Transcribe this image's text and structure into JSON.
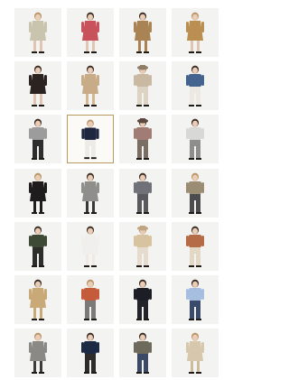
{
  "colors": {
    "skin": "#e9cdb7",
    "hair_dark": "#3b2a20",
    "hair_light": "#b99466",
    "selected_border": "#b89a5e",
    "tile_bg": "#f3f3f1"
  },
  "grid": {
    "columns": 4,
    "selected_index": 9,
    "items": [
      {
        "icon": "model-light-dress-icon",
        "top": "#c9c4ad",
        "bottom": "#c9c4ad",
        "legs": "#e0c6b2",
        "dress": true
      },
      {
        "icon": "model-floral-dress-icon",
        "top": "#c8525b",
        "bottom": "#d9c6c2",
        "legs": "#e0c6b2",
        "dress": true
      },
      {
        "icon": "model-camel-dress-icon",
        "top": "#a98353",
        "bottom": "#a98353",
        "legs": "#a98353",
        "dress": true
      },
      {
        "icon": "model-print-dress-icon",
        "top": "#bb8e52",
        "bottom": "#d3b07a",
        "legs": "#e0c6b2",
        "dress": true
      },
      {
        "icon": "model-black-dress-icon",
        "top": "#2b2320",
        "bottom": "#3a302b",
        "legs": "#e0c6b2",
        "dress": true
      },
      {
        "icon": "model-beige-coat-icon",
        "top": "#c8ab87",
        "bottom": "#c8ab87",
        "legs": "#d2b891",
        "dress": true
      },
      {
        "icon": "model-check-sweater-icon",
        "top": "#c9b9a2",
        "bottom": "#ddd3c3",
        "legs": "#ddd3c3",
        "dress": false,
        "hat": "#8f7d68"
      },
      {
        "icon": "model-denim-jacket-icon",
        "top": "#44638e",
        "bottom": "#ece8e2",
        "legs": "#ece8e2",
        "dress": false
      },
      {
        "icon": "model-grey-sweater-icon",
        "top": "#9c9c9c",
        "bottom": "#2e2e2e",
        "legs": "#2e2e2e",
        "dress": false
      },
      {
        "icon": "model-navy-cardigan-icon",
        "top": "#1e2640",
        "bottom": "#ecebe8",
        "legs": "#ecebe8",
        "dress": false
      },
      {
        "icon": "model-mauve-sweater-icon",
        "top": "#a07c74",
        "bottom": "#7a6e62",
        "legs": "#7a6e62",
        "dress": false,
        "hat": "#5c4a40"
      },
      {
        "icon": "model-white-knit-icon",
        "top": "#d8d8d6",
        "bottom": "#8e8e8c",
        "legs": "#8e8e8c",
        "dress": false
      },
      {
        "icon": "model-black-coat-icon",
        "top": "#1e1c1c",
        "bottom": "#1e1c1c",
        "legs": "#1e1c1c",
        "dress": true
      },
      {
        "icon": "model-grey-coat-icon",
        "top": "#8f8e8a",
        "bottom": "#3a3836",
        "legs": "#3a3836",
        "dress": true
      },
      {
        "icon": "model-argyle-sweater-icon",
        "top": "#6f7078",
        "bottom": "#5a5a5e",
        "legs": "#5a5a5e",
        "dress": false
      },
      {
        "icon": "model-argyle-vest-icon",
        "top": "#9b8c74",
        "bottom": "#4c4c4e",
        "legs": "#4c4c4e",
        "dress": false
      },
      {
        "icon": "model-green-outfit-icon",
        "top": "#3f4a36",
        "bottom": "#2d2d2a",
        "legs": "#2d2d2a",
        "dress": false
      },
      {
        "icon": "model-white-outfit-icon",
        "top": "#f0efec",
        "bottom": "#f0efec",
        "legs": "#efe9df",
        "dress": true
      },
      {
        "icon": "model-beige-knit-icon",
        "top": "#d8c3a1",
        "bottom": "#e6dccd",
        "legs": "#e6dccd",
        "dress": false,
        "hat": "#c0a583"
      },
      {
        "icon": "model-pattern-sweater-icon",
        "top": "#b56b45",
        "bottom": "#e3d8c6",
        "legs": "#e3d8c6",
        "dress": false
      },
      {
        "icon": "model-trench-coat-icon",
        "top": "#c9a977",
        "bottom": "#c9a977",
        "legs": "#c9a977",
        "dress": true
      },
      {
        "icon": "model-colorblock-sweater-icon",
        "top": "#c45b3b",
        "bottom": "#7c7a76",
        "legs": "#7c7a76",
        "dress": false
      },
      {
        "icon": "model-black-top-icon",
        "top": "#1d1d25",
        "bottom": "#23232c",
        "legs": "#23232c",
        "dress": false
      },
      {
        "icon": "model-blue-shirt-icon",
        "top": "#a6bfe0",
        "bottom": "#3b4b6b",
        "legs": "#3b4b6b",
        "dress": false
      },
      {
        "icon": "model-grey-wool-coat-icon",
        "top": "#8b8985",
        "bottom": "#8b8985",
        "legs": "#3e3c39",
        "dress": true
      },
      {
        "icon": "model-navy-sweater-icon",
        "top": "#1d2a44",
        "bottom": "#2d2c2b",
        "legs": "#2d2c2b",
        "dress": false
      },
      {
        "icon": "model-camo-jacket-icon",
        "top": "#6d6a5c",
        "bottom": "#3a4a66",
        "legs": "#3a4a66",
        "dress": false
      },
      {
        "icon": "model-cream-coat-icon",
        "top": "#d7c7ac",
        "bottom": "#d7c7ac",
        "legs": "#cdbb9c",
        "dress": true
      }
    ]
  }
}
